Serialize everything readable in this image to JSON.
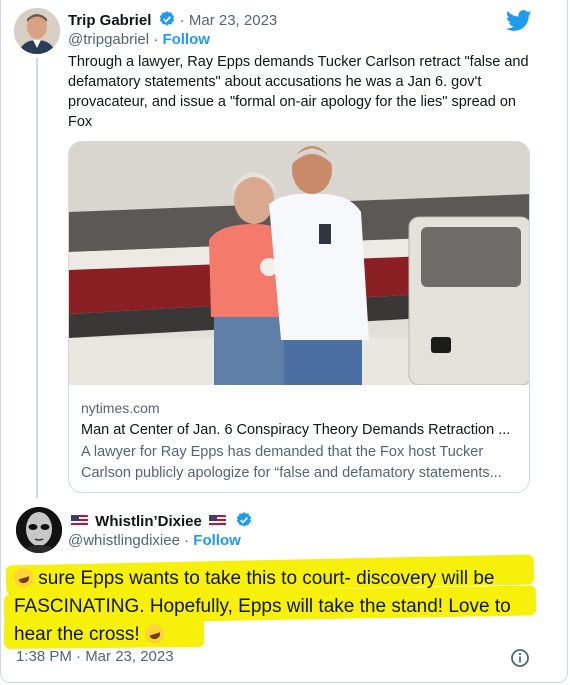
{
  "quoted_tweet": {
    "author_name": "Trip Gabriel",
    "date": "Mar 23, 2023",
    "handle": "@tripgabriel",
    "follow_label": "Follow",
    "separator": "·",
    "text": "Through a lawyer, Ray Epps demands Tucker Carlson retract \"false and defamatory statements\" about accusations he was a Jan 6. gov't provacateur, and issue a \"formal on-air apology for the lies\" spread on Fox",
    "card": {
      "domain": "nytimes.com",
      "title": "Man at Center of Jan. 6 Conspiracy Theory Demands Retraction ...",
      "description": "A lawyer for Ray Epps has demanded that the Fox host Tucker Carlson publicly apologize for “false and defamatory statements..."
    }
  },
  "reply_tweet": {
    "author_name": "Whistlin’Dixiee",
    "handle": "@whistlingdixiee",
    "follow_label": "Follow",
    "separator": "·",
    "text_part1": " sure Epps wants to take this to court- discovery will be FASCINATING. Hopefully, Epps will take the stand! Love to hear the cross! ",
    "timestamp": "1:38 PM · Mar 23, 2023",
    "highlight_color": "#f6f00a"
  },
  "icons": {
    "verified": "verified-badge-icon",
    "twitter": "twitter-bird-icon",
    "info": "info-icon",
    "emoji": "rolling-on-floor-laughing-emoji"
  },
  "colors": {
    "accent": "#1d9bf0",
    "muted": "#536471",
    "text": "#0f1419",
    "border": "#cfd9de"
  }
}
